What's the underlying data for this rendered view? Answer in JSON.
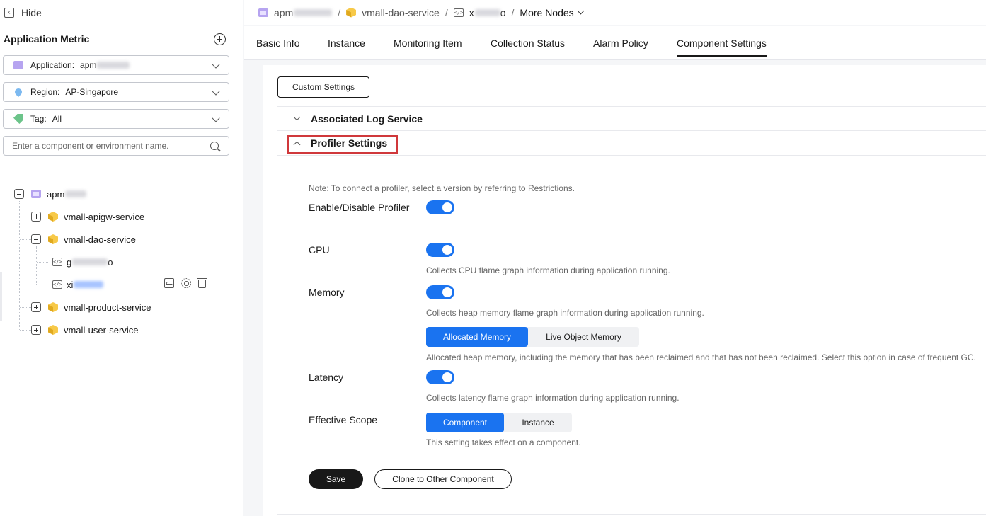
{
  "sidebar": {
    "hide_label": "Hide",
    "title": "Application Metric",
    "application": {
      "label": "Application:",
      "value": "apm"
    },
    "region": {
      "label": "Region:",
      "value": "AP-Singapore"
    },
    "tag": {
      "label": "Tag:",
      "value": "All"
    },
    "search": {
      "placeholder": "Enter a component or environment name."
    },
    "tree": {
      "root": "apm",
      "nodes": [
        {
          "label": "vmall-apigw-service",
          "expanded": false
        },
        {
          "label": "vmall-dao-service",
          "expanded": true
        },
        {
          "label": "g",
          "suffix": "o"
        },
        {
          "label": "xi"
        },
        {
          "label": "vmall-product-service",
          "expanded": false
        },
        {
          "label": "vmall-user-service",
          "expanded": false
        }
      ]
    }
  },
  "breadcrumb": {
    "app": "apm",
    "service": "vmall-dao-service",
    "env_prefix": "x",
    "env_suffix": "o",
    "more": "More Nodes"
  },
  "tabs": [
    "Basic Info",
    "Instance",
    "Monitoring Item",
    "Collection Status",
    "Alarm Policy",
    "Component Settings"
  ],
  "content": {
    "custom_settings": "Custom Settings",
    "associated_log": "Associated Log Service",
    "profiler_settings": "Profiler Settings",
    "note": "Note: To connect a profiler, select a version by referring to Restrictions.",
    "enable_label": "Enable/Disable Profiler",
    "cpu_label": "CPU",
    "cpu_desc": "Collects CPU flame graph information during application running.",
    "memory_label": "Memory",
    "memory_desc": "Collects heap memory flame graph information during application running.",
    "memory_options": [
      "Allocated Memory",
      "Live Object Memory"
    ],
    "memory_option_desc": "Allocated heap memory, including the memory that has been reclaimed and that has not been reclaimed. Select this option in case of frequent GC.",
    "latency_label": "Latency",
    "latency_desc": "Collects latency flame graph information during application running.",
    "scope_label": "Effective Scope",
    "scope_options": [
      "Component",
      "Instance"
    ],
    "scope_desc": "This setting takes effect on a component.",
    "save": "Save",
    "clone": "Clone to Other Component"
  },
  "colors": {
    "accent": "#1a73f0",
    "highlight": "#d0383b",
    "primary_dark": "#191919"
  }
}
